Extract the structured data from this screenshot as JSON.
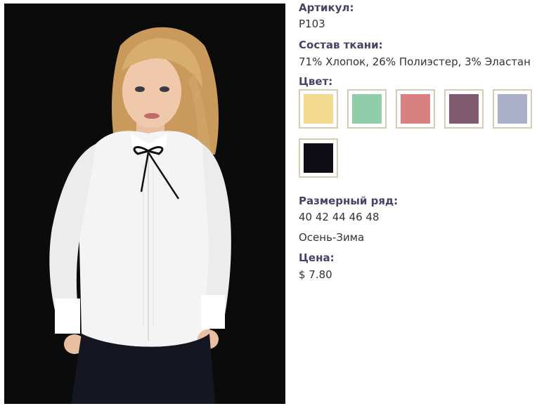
{
  "product": {
    "photo_alt": "Женская белая блузка с бантом",
    "article_label": "Артикул:",
    "article_value": "P103",
    "composition_label": "Состав ткани:",
    "composition_value": "71% Хлопок, 26% Полиэстер, 3% Эластан",
    "color_label": "Цвет:",
    "colors": [
      {
        "name": "yellow",
        "hex": "#f2db90"
      },
      {
        "name": "mint",
        "hex": "#8fcea9"
      },
      {
        "name": "pink",
        "hex": "#d98081"
      },
      {
        "name": "mauve",
        "hex": "#7e5a6c"
      },
      {
        "name": "lavender-gray",
        "hex": "#aab0c8"
      },
      {
        "name": "black",
        "hex": "#0e0e14"
      }
    ],
    "sizes_label": "Размерный ряд:",
    "sizes_value": "40 42 44 46 48",
    "season": "Осень-Зима",
    "price_label": "Цена:",
    "price_value": "$ 7.80"
  },
  "colors": {
    "label": "#4a4166",
    "swatch_border": "#d6ccb4",
    "photo_bg": "#0b0b0b"
  }
}
